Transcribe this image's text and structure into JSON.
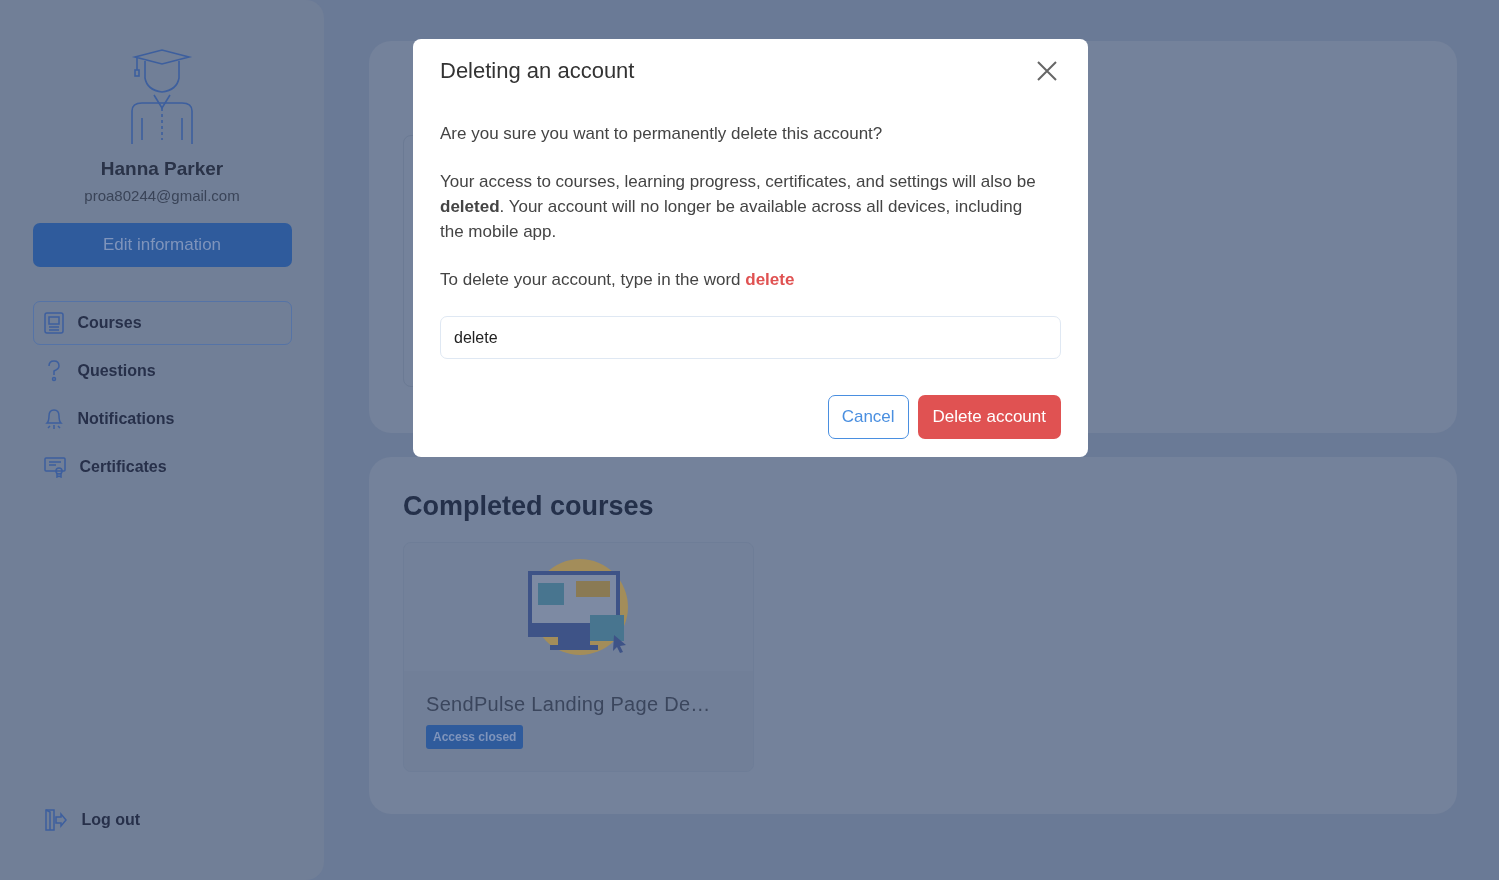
{
  "profile": {
    "name": "Hanna Parker",
    "email": "proa80244@gmail.com",
    "edit_button": "Edit information"
  },
  "nav": [
    {
      "label": "Courses",
      "selected": true
    },
    {
      "label": "Questions",
      "selected": false
    },
    {
      "label": "Notifications",
      "selected": false
    },
    {
      "label": "Certificates",
      "selected": false
    }
  ],
  "logout": "Log out",
  "completed": {
    "title": "Completed courses",
    "courses": [
      {
        "title": "SendPulse Landing Page De…",
        "badge": "Access closed"
      }
    ]
  },
  "dialog": {
    "title": "Deleting an account",
    "question": "Are you sure you want to permanently delete this account?",
    "warning": "Your access to courses, learning progress, certificates, and settings will also be **deleted**. Your account will no longer be available across all devices, including the mobile app.",
    "instruction": "To delete your account, type in the word",
    "keyword": "delete",
    "input_value": "delete",
    "buttons": {
      "cancel": "Cancel",
      "confirm": "Delete account"
    }
  }
}
